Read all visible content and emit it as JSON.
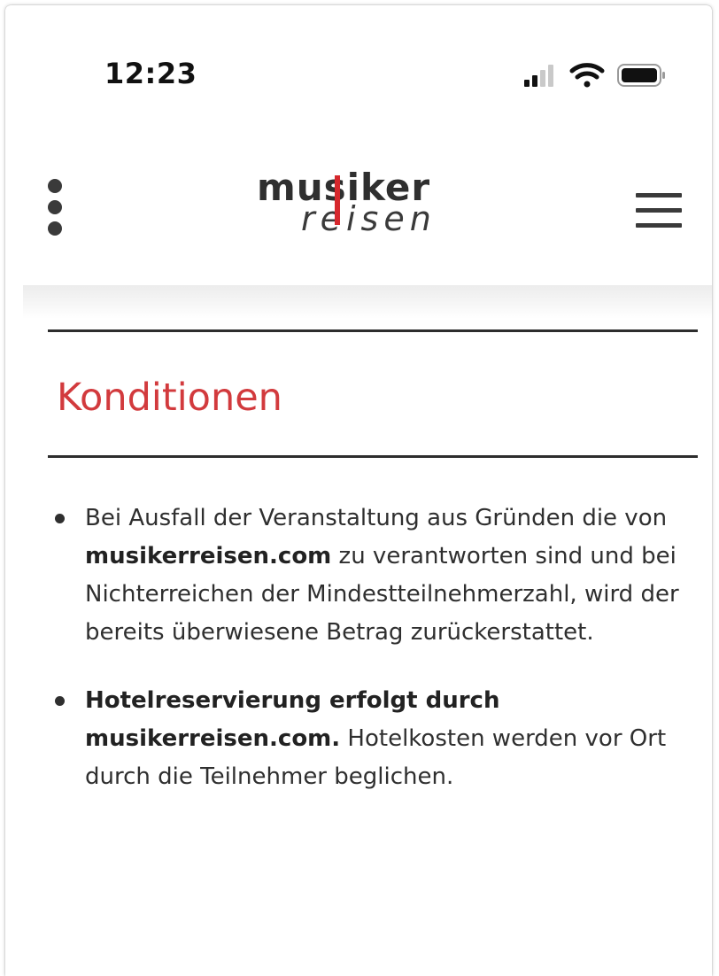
{
  "status_bar": {
    "time": "12:23",
    "icons": [
      "cellular-signal-icon",
      "wifi-icon",
      "battery-icon"
    ]
  },
  "header": {
    "logo_text_top": "musiker",
    "logo_text_bottom": "reisen",
    "logo_accent_color": "#d6282d",
    "left_icon": "kebab-menu-icon",
    "right_icon": "hamburger-menu-icon"
  },
  "page": {
    "title": "Konditionen",
    "title_color": "#d23a3d"
  },
  "conditions": [
    {
      "t1": "Bei Ausfall der Veranstaltung aus Gründen die von ",
      "b1": "musikerreisen.com",
      "t2": " zu verantworten sind und bei Nichterreichen der Mindestteilnehmerzahl, wird der bereits überwiesene Betrag zurückerstattet."
    },
    {
      "b1": "Hotelreservierung erfolgt durch musikerreisen.com.",
      "t2": " Hotelkosten werden vor Ort durch die Teilnehmer beglichen."
    }
  ]
}
